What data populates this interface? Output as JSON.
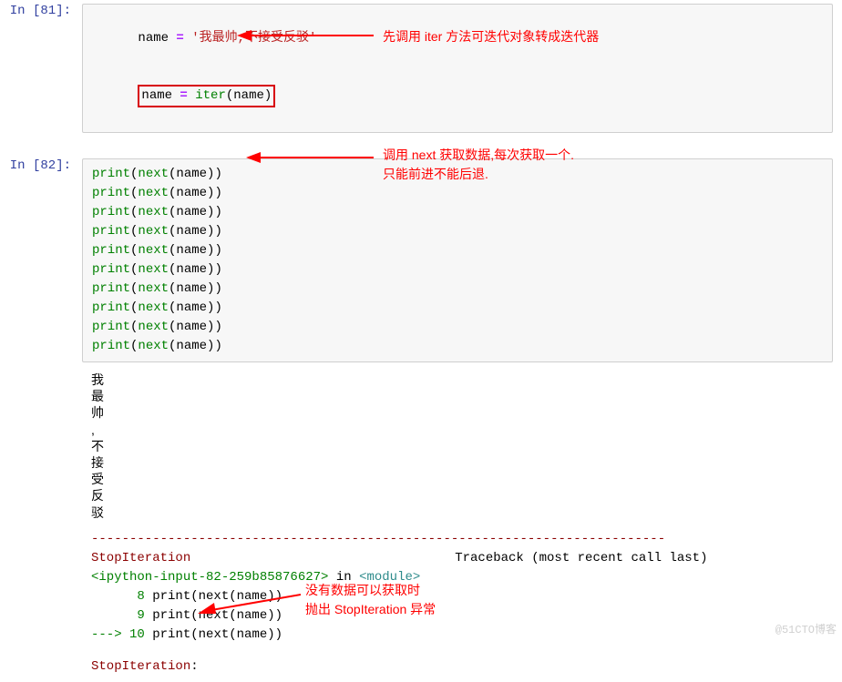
{
  "cell1": {
    "prompt": "In  [81]:",
    "line1": {
      "name": "name",
      "eq": " = ",
      "str": "'我最帅,不接受反驳'"
    },
    "line2": {
      "name": "name",
      "eq": " = ",
      "fn": "iter",
      "paren_open": "(",
      "arg": "name",
      "paren_close": ")"
    }
  },
  "annotations": {
    "a1": "先调用 iter 方法可迭代对象转成迭代器",
    "a2_line1": "调用 next 获取数据,每次获取一个.",
    "a2_line2": "只能前进不能后退.",
    "a3_line1": "没有数据可以获取时",
    "a3_line2": "抛出 StopIteration 异常"
  },
  "cell2": {
    "prompt": "In  [82]:",
    "print_lines": [
      "print(next(name))",
      "print(next(name))",
      "print(next(name))",
      "print(next(name))",
      "print(next(name))",
      "print(next(name))",
      "print(next(name))",
      "print(next(name))",
      "print(next(name))",
      "print(next(name))"
    ]
  },
  "output": {
    "chars": [
      "我",
      "最",
      "帅",
      ",",
      "不",
      "接",
      "受",
      "反",
      "驳"
    ],
    "sep": "---------------------------------------------------------------------------",
    "err_name": "StopIteration",
    "tb_label": "Traceback (most recent call last)",
    "ipy_marker": "<ipython-input-82-259b85876627>",
    "in_word": " in ",
    "module": "<module>",
    "line8_num": "      8 ",
    "line8_code": "print(next(name))",
    "line9_num": "      9 ",
    "line9_code": "print(next(name))",
    "line10_arrow": "---> ",
    "line10_num": "10 ",
    "line10_code": "print(next(name))",
    "err_final": "StopIteration",
    "err_colon": ": "
  },
  "watermark": "@51CTO博客"
}
